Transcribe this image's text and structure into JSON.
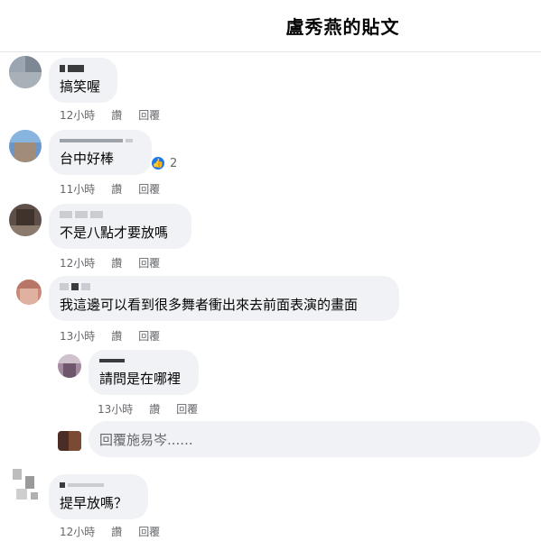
{
  "header": {
    "title": "盧秀燕的貼文"
  },
  "comments": [
    {
      "text": "搞笑喔",
      "time": "12小時",
      "like": "讚",
      "reply": "回覆"
    },
    {
      "text": "台中好棒",
      "time": "11小時",
      "like": "讚",
      "reply": "回覆",
      "reaction_count": "2"
    },
    {
      "text": "不是八點才要放嗎",
      "time": "12小時",
      "like": "讚",
      "reply": "回覆"
    },
    {
      "text": "我這邊可以看到很多舞者衝出來去前面表演的畫面",
      "time": "13小時",
      "like": "讚",
      "reply": "回覆"
    },
    {
      "text": "請問是在哪裡",
      "time": "13小時",
      "like": "讚",
      "reply": "回覆"
    },
    {
      "text": "提早放嗎？",
      "time": "12小時",
      "like": "讚",
      "reply": "回覆"
    }
  ],
  "reply_input": {
    "placeholder": "回覆施易岑......"
  },
  "icons": {
    "like_reaction": "thumbs-up-icon"
  },
  "colors": {
    "accent": "#1877f2",
    "bubble": "#f0f2f5",
    "meta": "#65676b"
  }
}
